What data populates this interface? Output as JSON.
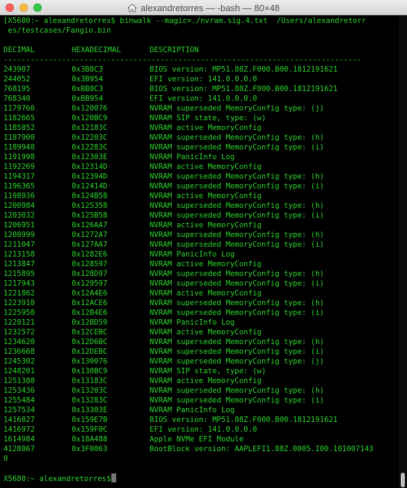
{
  "window": {
    "title": "alexandretorres — -bash — 80×48"
  },
  "terminal": {
    "command_line_1": "[X5680:~ alexandretorres$ binwalk --magic=./nvram.sig.4.txt  /Users/alexandretorr",
    "command_line_2": " es/testcases/Fangio.bin",
    "header": {
      "decimal": "DECIMAL",
      "hexadecimal": "HEXADECIMAL",
      "description": "DESCRIPTION"
    },
    "separator": "--------------------------------------------------------------------------------",
    "rows": [
      {
        "dec": "243907",
        "hex": "0x3B8C3",
        "desc": "BIOS version: MP51.88Z.F000.B00.1812191621"
      },
      {
        "dec": "244052",
        "hex": "0x3B954",
        "desc": "EFI version: 141.0.0.0.0"
      },
      {
        "dec": "768195",
        "hex": "0xBB8C3",
        "desc": "BIOS version: MP51.88Z.F000.B00.1812191621"
      },
      {
        "dec": "768340",
        "hex": "0xBB954",
        "desc": "EFI version: 141.0.0.0.0"
      },
      {
        "dec": "1179766",
        "hex": "0x120076",
        "desc": "NVRAM superseded MemoryConfig type: (j)"
      },
      {
        "dec": "1182665",
        "hex": "0x120BC9",
        "desc": "NVRAM SIP state, type: (w)"
      },
      {
        "dec": "1185852",
        "hex": "0x12183C",
        "desc": "NVRAM active MemoryConfig"
      },
      {
        "dec": "1187900",
        "hex": "0x12203C",
        "desc": "NVRAM superseded MemoryConfig type: (h)"
      },
      {
        "dec": "1189948",
        "hex": "0x12283C",
        "desc": "NVRAM superseded MemoryConfig type: (i)"
      },
      {
        "dec": "1191998",
        "hex": "0x12303E",
        "desc": "NVRAM PanicInfo Log"
      },
      {
        "dec": "1192269",
        "hex": "0x12314D",
        "desc": "NVRAM active MemoryConfig"
      },
      {
        "dec": "1194317",
        "hex": "0x12394D",
        "desc": "NVRAM superseded MemoryConfig type: (h)"
      },
      {
        "dec": "1196365",
        "hex": "0x12414D",
        "desc": "NVRAM superseded MemoryConfig type: (i)"
      },
      {
        "dec": "1198936",
        "hex": "0x124B58",
        "desc": "NVRAM active MemoryConfig"
      },
      {
        "dec": "1200984",
        "hex": "0x125358",
        "desc": "NVRAM superseded MemoryConfig type: (h)"
      },
      {
        "dec": "1203032",
        "hex": "0x125B58",
        "desc": "NVRAM superseded MemoryConfig type: (i)"
      },
      {
        "dec": "1206951",
        "hex": "0x126AA7",
        "desc": "NVRAM active MemoryConfig"
      },
      {
        "dec": "1208999",
        "hex": "0x1272A7",
        "desc": "NVRAM superseded MemoryConfig type: (h)"
      },
      {
        "dec": "1211047",
        "hex": "0x127AA7",
        "desc": "NVRAM superseded MemoryConfig type: (i)"
      },
      {
        "dec": "1213158",
        "hex": "0x1282E6",
        "desc": "NVRAM PanicInfo Log"
      },
      {
        "dec": "1213847",
        "hex": "0x128597",
        "desc": "NVRAM active MemoryConfig"
      },
      {
        "dec": "1215895",
        "hex": "0x128D97",
        "desc": "NVRAM superseded MemoryConfig type: (h)"
      },
      {
        "dec": "1217943",
        "hex": "0x129597",
        "desc": "NVRAM superseded MemoryConfig type: (i)"
      },
      {
        "dec": "1221862",
        "hex": "0x12A4E6",
        "desc": "NVRAM active MemoryConfig"
      },
      {
        "dec": "1223910",
        "hex": "0x12ACE6",
        "desc": "NVRAM superseded MemoryConfig type: (h)"
      },
      {
        "dec": "1225958",
        "hex": "0x12B4E6",
        "desc": "NVRAM superseded MemoryConfig type: (i)"
      },
      {
        "dec": "1228121",
        "hex": "0x12BD59",
        "desc": "NVRAM PanicInfo Log"
      },
      {
        "dec": "1232572",
        "hex": "0x12CEBC",
        "desc": "NVRAM active MemoryConfig"
      },
      {
        "dec": "1234620",
        "hex": "0x12D6BC",
        "desc": "NVRAM superseded MemoryConfig type: (h)"
      },
      {
        "dec": "1236668",
        "hex": "0x12DEBC",
        "desc": "NVRAM superseded MemoryConfig type: (i)"
      },
      {
        "dec": "1245302",
        "hex": "0x130076",
        "desc": "NVRAM superseded MemoryConfig type: (j)"
      },
      {
        "dec": "1248201",
        "hex": "0x130BC9",
        "desc": "NVRAM SIP state, type: (w)"
      },
      {
        "dec": "1251388",
        "hex": "0x13183C",
        "desc": "NVRAM active MemoryConfig"
      },
      {
        "dec": "1253436",
        "hex": "0x13203C",
        "desc": "NVRAM superseded MemoryConfig type: (h)"
      },
      {
        "dec": "1255484",
        "hex": "0x13283C",
        "desc": "NVRAM superseded MemoryConfig type: (i)"
      },
      {
        "dec": "1257534",
        "hex": "0x13303E",
        "desc": "NVRAM PanicInfo Log"
      },
      {
        "dec": "1416827",
        "hex": "0x159E7B",
        "desc": "BIOS version: MP51.88Z.F000.B00.1812191621"
      },
      {
        "dec": "1416972",
        "hex": "0x159F0C",
        "desc": "EFI version: 141.0.0.0.0"
      },
      {
        "dec": "1614984",
        "hex": "0x18A488",
        "desc": "Apple NVMe EFI Module"
      },
      {
        "dec": "4128867",
        "hex": "0x3F0063",
        "desc": "BootBlock version: AAPLEFI1.88Z.0005.I00.101007143"
      }
    ],
    "wrap_line": "0",
    "prompt": "X5680:~ alexandretorres$"
  },
  "colors": {
    "text": "#2bd62b",
    "background": "#000000",
    "titlebar": "#e4e4e4"
  }
}
